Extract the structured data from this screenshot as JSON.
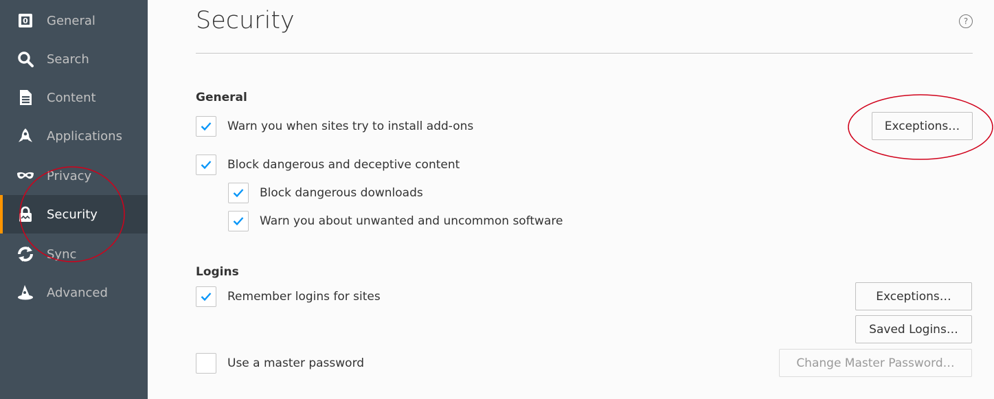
{
  "sidebar": {
    "items": [
      {
        "label": "General",
        "icon": "general-icon"
      },
      {
        "label": "Search",
        "icon": "search-icon"
      },
      {
        "label": "Content",
        "icon": "document-icon"
      },
      {
        "label": "Applications",
        "icon": "rocket-icon"
      },
      {
        "label": "Privacy",
        "icon": "mask-icon"
      },
      {
        "label": "Security",
        "icon": "lock-icon",
        "selected": true
      },
      {
        "label": "Sync",
        "icon": "sync-icon"
      },
      {
        "label": "Advanced",
        "icon": "wizard-hat-icon"
      }
    ]
  },
  "page": {
    "title": "Security",
    "help_symbol": "?"
  },
  "general": {
    "heading": "General",
    "warn_addons": {
      "label": "Warn you when sites try to install add-ons",
      "checked": true
    },
    "addons_exceptions_button": "Exceptions…",
    "block_dangerous": {
      "label": "Block dangerous and deceptive content",
      "checked": true
    },
    "block_downloads": {
      "label": "Block dangerous downloads",
      "checked": true
    },
    "warn_unwanted": {
      "label": "Warn you about unwanted and uncommon software",
      "checked": true
    }
  },
  "logins": {
    "heading": "Logins",
    "remember_logins": {
      "label": "Remember logins for sites",
      "checked": true
    },
    "exceptions_button": "Exceptions…",
    "saved_logins_button": "Saved Logins…",
    "master_password": {
      "label": "Use a master password",
      "checked": false
    },
    "change_master_button": "Change Master Password…"
  },
  "colors": {
    "sidebar_bg": "#424f5a",
    "sidebar_selected_bg": "#343f48",
    "accent": "#ff9500",
    "checkmark": "#0996f8",
    "annotation": "#d0021b"
  }
}
